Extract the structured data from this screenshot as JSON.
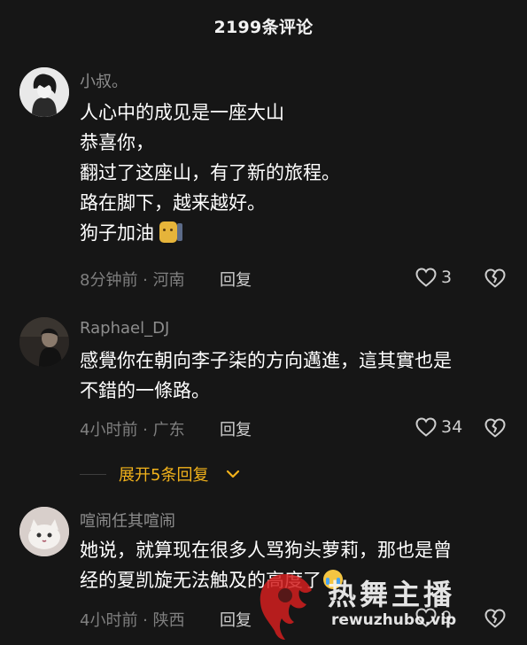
{
  "header": {
    "title": "2199条评论"
  },
  "comments": [
    {
      "username": "小叔。",
      "lines": [
        "人心中的成见是一座大山",
        "恭喜你，",
        "翻过了这座山，有了新的旅程。",
        "路在脚下，越来越好。",
        "狗子加油"
      ],
      "emoji": "dog-emoji",
      "time_location": "8分钟前 · 河南",
      "reply_label": "回复",
      "like_count": "3"
    },
    {
      "username": "Raphael_DJ",
      "lines": [
        "感覺你在朝向李子柒的方向邁進，這其實也是",
        "不錯的一條路。"
      ],
      "time_location": "4小时前 · 广东",
      "reply_label": "回复",
      "like_count": "34"
    },
    {
      "username": "喧闹任其喧闹",
      "lines": [
        "她说，就算现在很多人骂狗头萝莉，那也是曾",
        "经的夏凯旋无法触及的高度了"
      ],
      "emoji": "crying-emoji",
      "time_location": "4小时前 · 陕西",
      "reply_label": "回复",
      "like_count": "9"
    }
  ],
  "expand_replies": {
    "label": "展开5条回复"
  },
  "watermark": {
    "title": "热舞主播",
    "url": "rewuzhubo.vip"
  },
  "colors": {
    "background": "#161616",
    "accent": "#f2b21b",
    "muted": "#7f7f7f"
  },
  "icons": [
    "heart-icon",
    "broken-heart-icon",
    "chevron-down-icon"
  ]
}
